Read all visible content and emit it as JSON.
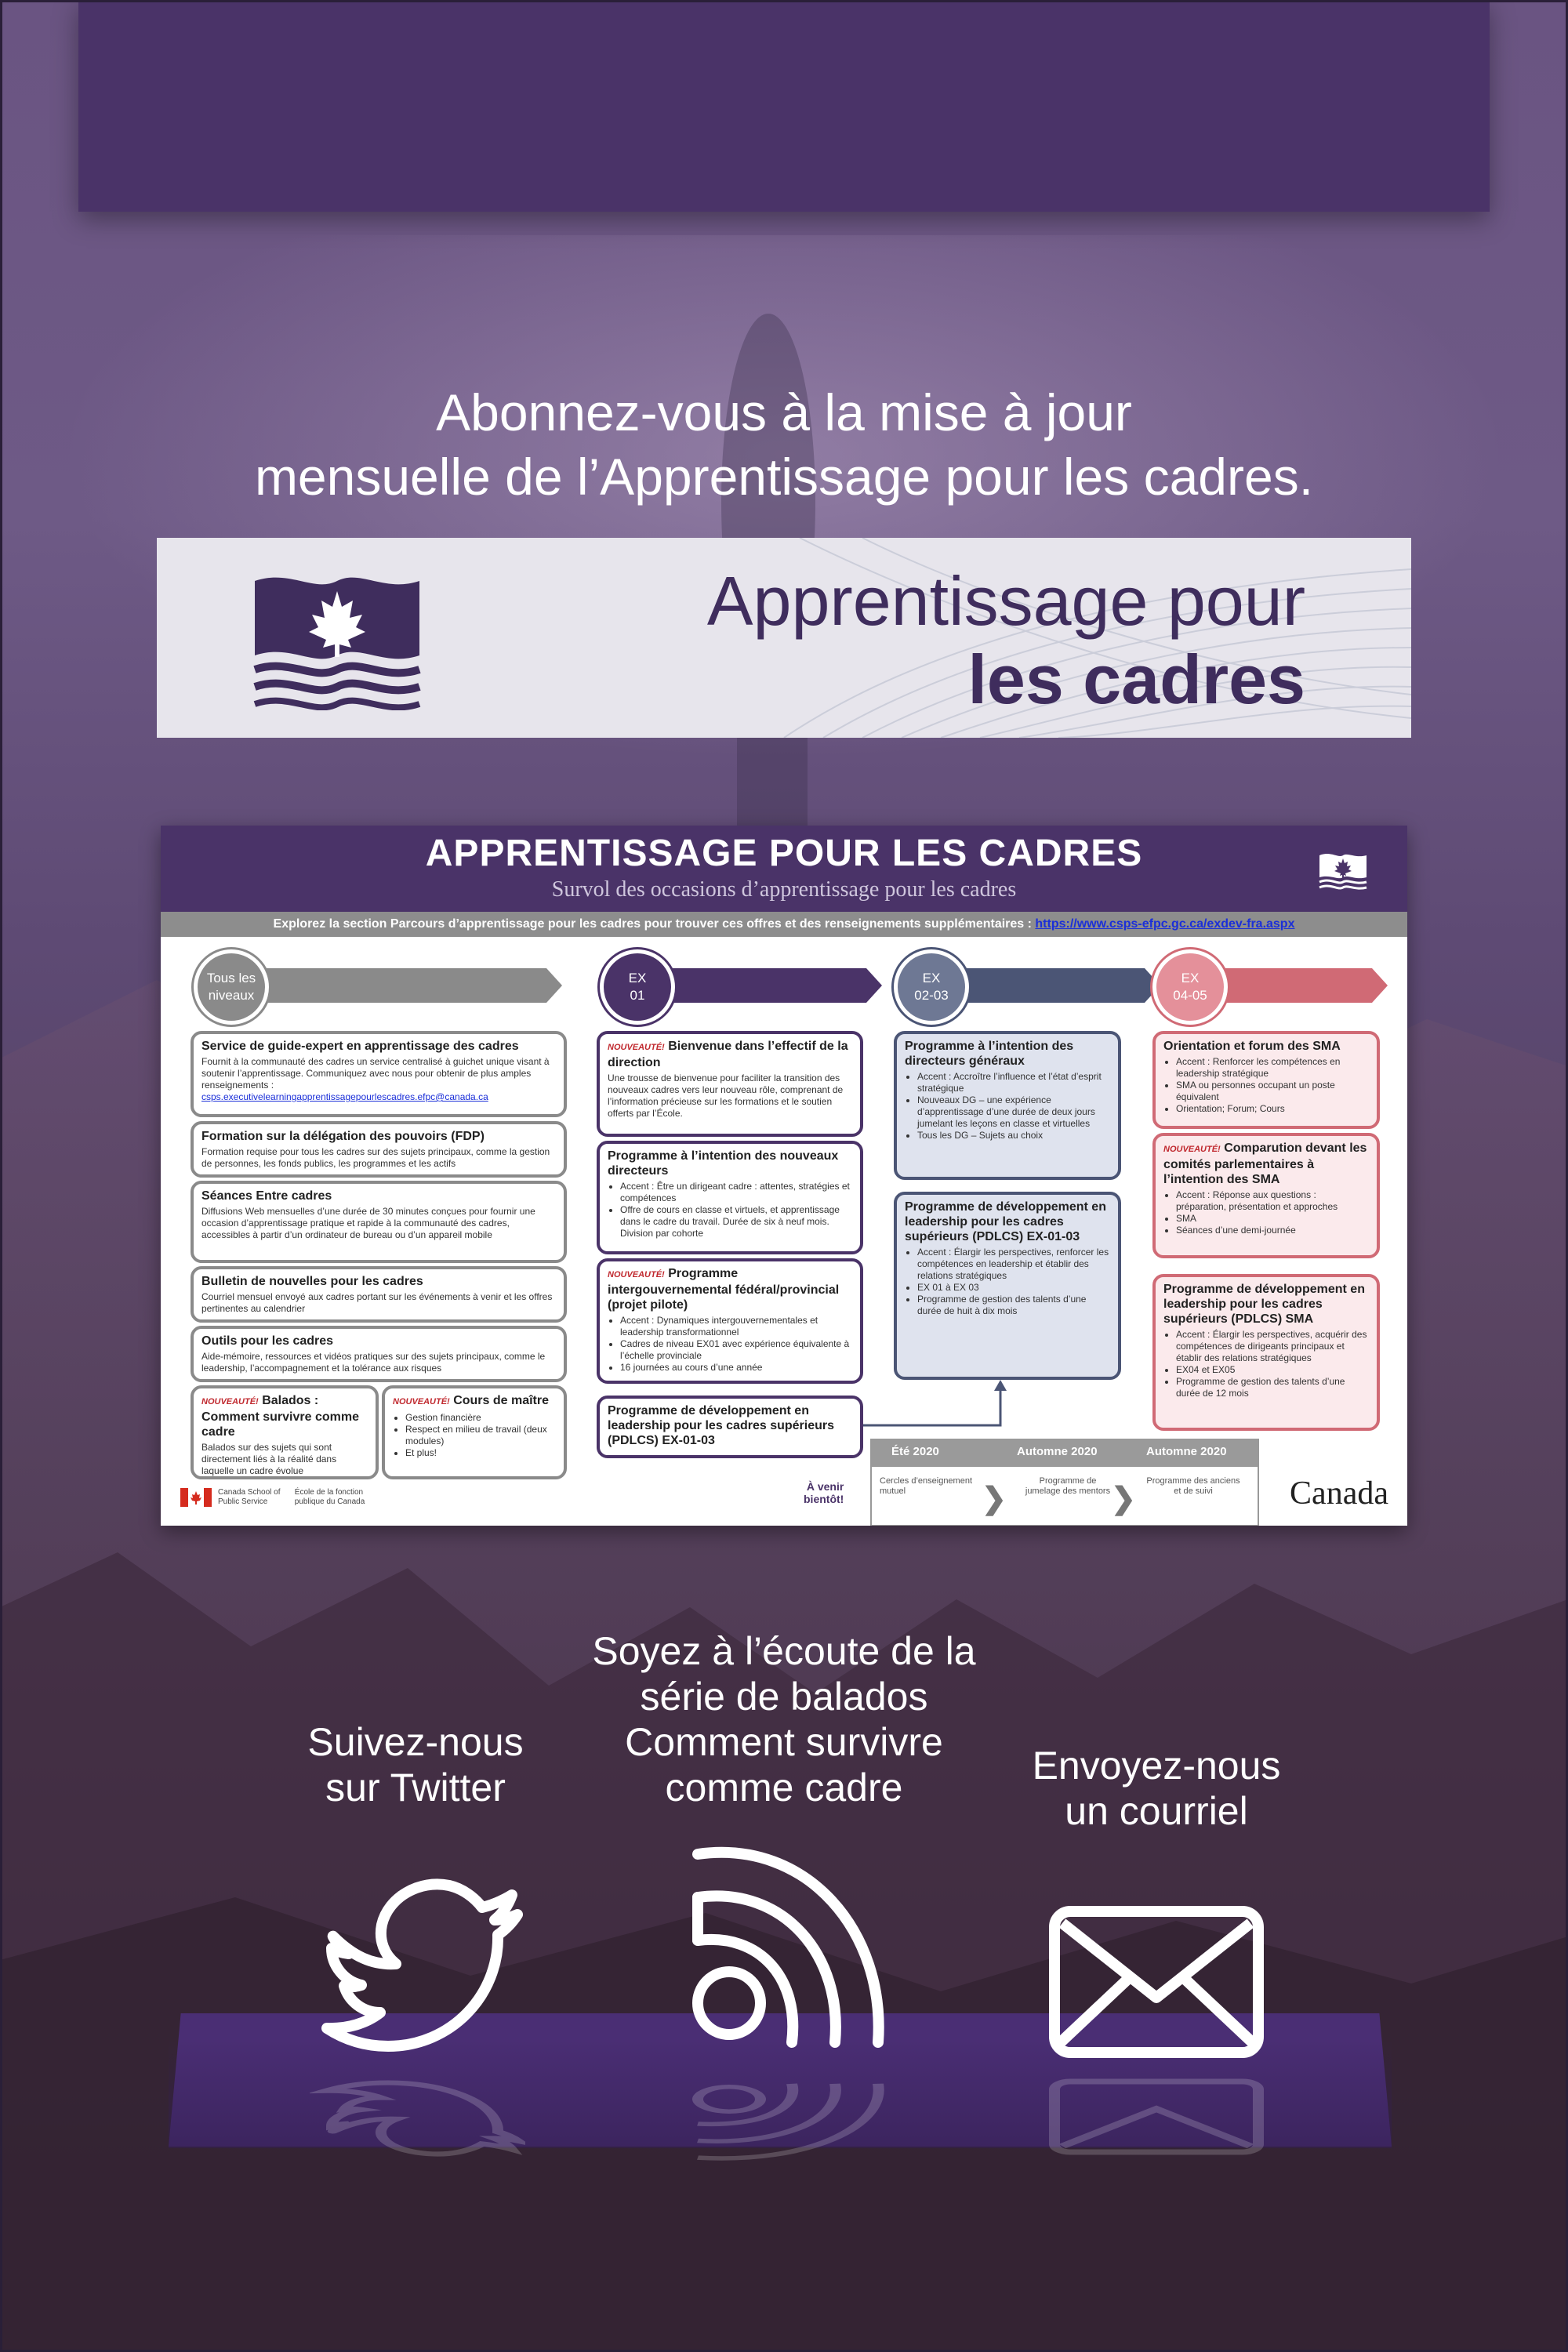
{
  "subscribe": {
    "line1": "Abonnez-vous à la mise à jour",
    "line2": "mensuelle de l’Apprentissage pour les cadres."
  },
  "brand": {
    "title_line1": "Apprentissage pour",
    "title_line2": "les cadres"
  },
  "infographic": {
    "title": "APPRENTISSAGE POUR LES CADRES",
    "subtitle": "Survol des occasions d’apprentissage pour les cadres",
    "explore_text": "Explorez la section Parcours d’apprentissage pour les cadres pour trouver ces offres et des renseignements supplémentaires :",
    "explore_link": "https://www.csps-efpc.gc.ca/exdev-fra.aspx",
    "columns": [
      {
        "label_line1": "Tous les",
        "label_line2": "niveaux",
        "color": "#8a8a8a"
      },
      {
        "label_line1": "EX",
        "label_line2": "01",
        "color": "#4a3368"
      },
      {
        "label_line1": "EX",
        "label_line2": "02-03",
        "color": "#4b5575"
      },
      {
        "label_line1": "EX",
        "label_line2": "04-05",
        "color": "#d06a75"
      }
    ],
    "all_levels": {
      "guide_title": "Service de guide-expert en apprentissage des cadres",
      "guide_text": "Fournit à la communauté des cadres un service centralisé à guichet unique visant à soutenir l’apprentissage. Communiquez avec nous pour obtenir de plus amples renseignements :",
      "guide_email": "csps.executivelearningapprentissagepourlescadres.efpc@canada.ca",
      "fdp_title": "Formation sur la délégation des pouvoirs (FDP)",
      "fdp_text": "Formation requise pour tous les cadres sur des sujets principaux, comme la gestion de personnes, les fonds publics, les programmes et les actifs",
      "seances_title": "Séances Entre cadres",
      "seances_text": "Diffusions Web mensuelles d’une durée de 30 minutes conçues pour fournir une occasion d’apprentissage pratique et rapide à la communauté des cadres, accessibles à partir d’un ordinateur de bureau ou d’un appareil mobile",
      "bulletin_title": "Bulletin de nouvelles pour les cadres",
      "bulletin_text": "Courriel mensuel envoyé aux cadres portant sur les événements à venir et les offres pertinentes au calendrier",
      "outils_title": "Outils pour les cadres",
      "outils_text": "Aide-mémoire, ressources et vidéos pratiques sur des sujets principaux, comme le leadership, l’accompagnement et la tolérance aux risques",
      "balados_new": "NOUVEAUTÉ!",
      "balados_title": "Balados : Comment survivre comme cadre",
      "balados_text": "Balados sur des sujets qui sont directement liés à la réalité dans laquelle un cadre évolue",
      "cours_new": "NOUVEAUTÉ!",
      "cours_title": "Cours de maître",
      "cours_items": [
        "Gestion financière",
        "Respect en milieu de travail (deux modules)",
        "Et plus!"
      ]
    },
    "ex01": {
      "bienvenue_new": "NOUVEAUTÉ!",
      "bienvenue_title": "Bienvenue dans l’effectif de la direction",
      "bienvenue_text": "Une trousse de bienvenue pour faciliter la transition des nouveaux cadres vers leur nouveau rôle, comprenant de l’information précieuse sur les formations et le soutien offerts par l’École.",
      "nouveaux_title": "Programme à l’intention des nouveaux directeurs",
      "nouveaux_items": [
        "Accent : Être un dirigeant cadre : attentes, stratégies et compétences",
        "Offre de cours en classe et virtuels, et apprentissage dans le cadre du travail. Durée de six à neuf mois. Division par cohorte"
      ],
      "intergouv_new": "NOUVEAUTÉ!",
      "intergouv_title": "Programme intergouvernemental fédéral/provincial (projet pilote)",
      "intergouv_items": [
        "Accent : Dynamiques intergouvernementales et leadership transformationnel",
        "Cadres de niveau EX01 avec expérience équivalente à l’échelle provinciale",
        "16 journées au cours d’une année"
      ],
      "pdlcs_title": "Programme de développement en leadership pour les cadres supérieurs (PDLCS) EX-01-03"
    },
    "ex0203": {
      "dg_title": "Programme à l’intention des directeurs généraux",
      "dg_items": [
        "Accent : Accroître l’influence et l’état d’esprit stratégique",
        "Nouveaux DG – une expérience d’apprentissage d’une durée de deux jours jumelant les leçons en classe et virtuelles",
        "Tous les DG – Sujets au choix"
      ],
      "pdlcs_title": "Programme de développement en leadership pour les cadres supérieurs (PDLCS) EX-01-03",
      "pdlcs_items": [
        "Accent : Élargir les perspectives, renforcer les compétences en leadership et établir des relations stratégiques",
        "EX 01 à EX 03",
        "Programme de gestion des talents d’une durée de huit à dix mois"
      ]
    },
    "ex0405": {
      "sma_title": "Orientation et forum des SMA",
      "sma_items": [
        "Accent : Renforcer les compétences en leadership stratégique",
        "SMA ou personnes occupant un poste équivalent",
        "Orientation; Forum; Cours"
      ],
      "comp_new": "NOUVEAUTÉ!",
      "comp_title": "Comparution devant les comités parlementaires à l’intention des SMA",
      "comp_items": [
        "Accent : Réponse aux questions : préparation, présentation et approches",
        "SMA",
        "Séances d’une demi-journée"
      ],
      "pdlcs_title": "Programme de développement en leadership pour les cadres supérieurs (PDLCS) SMA",
      "pdlcs_items": [
        "Accent : Élargir les perspectives, acquérir des compétences de dirigeants principaux et établir des relations stratégiques",
        "EX04 et EX05",
        "Programme de gestion des talents d’une durée de 12 mois"
      ]
    },
    "avenir_line1": "À venir",
    "avenir_line2": "bientôt!",
    "timeline": {
      "headers": [
        "Été 2020",
        "Automne 2020",
        "Automne 2020"
      ],
      "steps": [
        "Cercles d’enseignement mutuel",
        "Programme de jumelage des mentors",
        "Programme des anciens et de suivi"
      ]
    },
    "footer_school_en": "Canada School of Public Service",
    "footer_school_fr": "École de la fonction publique du Canada",
    "canada_wordmark": "Canada"
  },
  "social": {
    "twitter_line1": "Suivez-nous",
    "twitter_line2": "sur Twitter",
    "podcast_line1": "Soyez à l’écoute de la",
    "podcast_line2": "série de balados",
    "podcast_line3": "Comment survivre",
    "podcast_line4": "comme cadre",
    "email_line1": "Envoyez-nous",
    "email_line2": "un courriel",
    "icons": [
      "twitter-icon",
      "podcast-icon",
      "mail-icon"
    ]
  },
  "colors": {
    "brand_purple": "#4a3368",
    "slate": "#4b5575",
    "rose": "#d06a75",
    "gray": "#8a8a8a"
  }
}
